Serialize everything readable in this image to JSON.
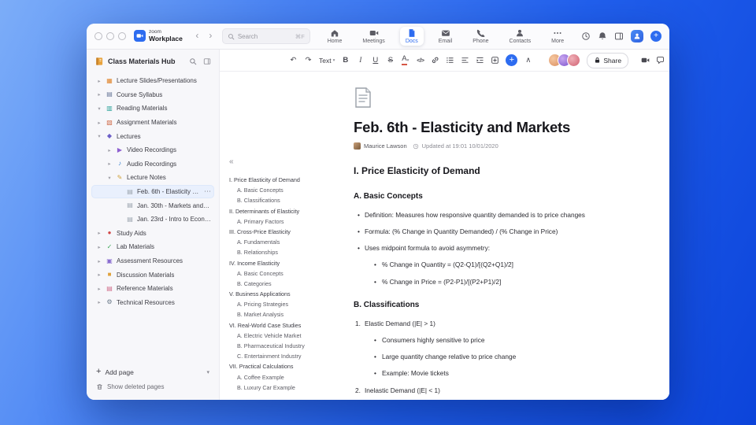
{
  "chrome": {
    "logo_top": "zoom",
    "logo_bottom": "Workplace",
    "search": {
      "placeholder": "Search",
      "shortcut": "⌘F"
    },
    "tabs": [
      {
        "label": "Home",
        "icon": "home"
      },
      {
        "label": "Meetings",
        "icon": "camera"
      },
      {
        "label": "Docs",
        "icon": "doc",
        "active": true
      },
      {
        "label": "Email",
        "icon": "mail"
      },
      {
        "label": "Phone",
        "icon": "phone"
      },
      {
        "label": "Contacts",
        "icon": "person"
      },
      {
        "label": "More",
        "icon": "dots"
      }
    ]
  },
  "sidebar": {
    "title": "Class Materials Hub",
    "items": [
      {
        "label": "Lecture Slides/Presentations",
        "icon": "presentation",
        "chevron": "right",
        "depth": 0
      },
      {
        "label": "Course Syllabus",
        "icon": "syllabus",
        "chevron": "right",
        "depth": 0
      },
      {
        "label": "Reading Materials",
        "icon": "book",
        "chevron": "down",
        "depth": 0
      },
      {
        "label": "Assignment Materials",
        "icon": "assignment",
        "chevron": "right",
        "depth": 0
      },
      {
        "label": "Lectures",
        "icon": "graduation",
        "chevron": "down",
        "depth": 0
      },
      {
        "label": "Video Recordings",
        "icon": "video",
        "chevron": "right",
        "depth": 1
      },
      {
        "label": "Audio Recordings",
        "icon": "audio",
        "chevron": "right",
        "depth": 1
      },
      {
        "label": "Lecture Notes",
        "icon": "notes",
        "chevron": "down",
        "depth": 1
      },
      {
        "label": "Feb. 6th - Elasticity and M...",
        "icon": "page",
        "depth": 2,
        "selected": true
      },
      {
        "label": "Jan. 30th - Markets and P...",
        "icon": "page",
        "depth": 2
      },
      {
        "label": "Jan. 23rd - Intro to Econo...",
        "icon": "page",
        "depth": 2
      },
      {
        "label": "Study Aids",
        "icon": "apple",
        "chevron": "right",
        "depth": 0
      },
      {
        "label": "Lab Materials",
        "icon": "lab",
        "chevron": "right",
        "depth": 0
      },
      {
        "label": "Assessment Resources",
        "icon": "assessment",
        "chevron": "right",
        "depth": 0
      },
      {
        "label": "Discussion Materials",
        "icon": "discussion",
        "chevron": "right",
        "depth": 0
      },
      {
        "label": "Reference Materials",
        "icon": "reference",
        "chevron": "right",
        "depth": 0
      },
      {
        "label": "Technical Resources",
        "icon": "technical",
        "chevron": "right",
        "depth": 0
      }
    ],
    "add_page_label": "Add page",
    "show_deleted_label": "Show deleted pages"
  },
  "toolbar": {
    "text_style_label": "Text",
    "bold_label": "B",
    "italic_label": "I",
    "underline_label": "U",
    "strikethrough_label": "S",
    "font_color_label": "A",
    "code_label": "</>",
    "share_label": "Share"
  },
  "document": {
    "title": "Feb. 6th - Elasticity and Markets",
    "author": "Maurice Lawson",
    "updated": "Updated at 19:01 10/01/2020",
    "outline": [
      {
        "text": "I. Price Elasticity of Demand",
        "level": 0
      },
      {
        "text": "A. Basic Concepts",
        "level": 1
      },
      {
        "text": "B. Classifications",
        "level": 1
      },
      {
        "text": "II. Determinants of Elasticity",
        "level": 0
      },
      {
        "text": "A. Primary Factors",
        "level": 1
      },
      {
        "text": "III. Cross-Price Elasticity",
        "level": 0
      },
      {
        "text": "A. Fundamentals",
        "level": 1
      },
      {
        "text": "B. Relationships",
        "level": 1
      },
      {
        "text": "IV. Income Elasticity",
        "level": 0
      },
      {
        "text": "A. Basic Concepts",
        "level": 1
      },
      {
        "text": "B. Categories",
        "level": 1
      },
      {
        "text": "V. Business Applications",
        "level": 0
      },
      {
        "text": "A. Pricing Strategies",
        "level": 1
      },
      {
        "text": "B. Market Analysis",
        "level": 1
      },
      {
        "text": "VI. Real-World Case Studies",
        "level": 0
      },
      {
        "text": "A. Electric Vehicle Market",
        "level": 1
      },
      {
        "text": "B. Pharmaceutical Industry",
        "level": 1
      },
      {
        "text": "C. Entertainment Industry",
        "level": 1
      },
      {
        "text": "VII. Practical Calculations",
        "level": 0
      },
      {
        "text": "A. Coffee Example",
        "level": 1
      },
      {
        "text": "B. Luxury Car Example",
        "level": 1
      }
    ],
    "blocks": [
      {
        "type": "h2",
        "text": "I. Price Elasticity of Demand"
      },
      {
        "type": "h3",
        "text": "A. Basic Concepts"
      },
      {
        "type": "bullet",
        "level": 1,
        "text": "Definition: Measures how responsive quantity demanded is to price changes"
      },
      {
        "type": "bullet",
        "level": 1,
        "text": "Formula: (% Change in Quantity Demanded) / (% Change in Price)"
      },
      {
        "type": "bullet",
        "level": 1,
        "text": "Uses midpoint formula to avoid asymmetry:"
      },
      {
        "type": "bullet",
        "level": 2,
        "text": "% Change in Quantity = (Q2-Q1)/[(Q2+Q1)/2]"
      },
      {
        "type": "bullet",
        "level": 2,
        "text": "% Change in Price = (P2-P1)/[(P2+P1)/2]"
      },
      {
        "type": "h3",
        "text": "B. Classifications"
      },
      {
        "type": "numbered",
        "marker": "1.",
        "text": "Elastic Demand (|E| > 1)"
      },
      {
        "type": "bullet",
        "level": 2,
        "text": "Consumers highly sensitive to price"
      },
      {
        "type": "bullet",
        "level": 2,
        "text": "Large quantity change relative to price change"
      },
      {
        "type": "bullet",
        "level": 2,
        "text": "Example: Movie tickets"
      },
      {
        "type": "numbered",
        "marker": "2.",
        "text": "Inelastic Demand (|E| < 1)"
      }
    ]
  },
  "colors": {
    "accent": "#2d6cf0",
    "selected_bg": "#e9f0fd"
  }
}
